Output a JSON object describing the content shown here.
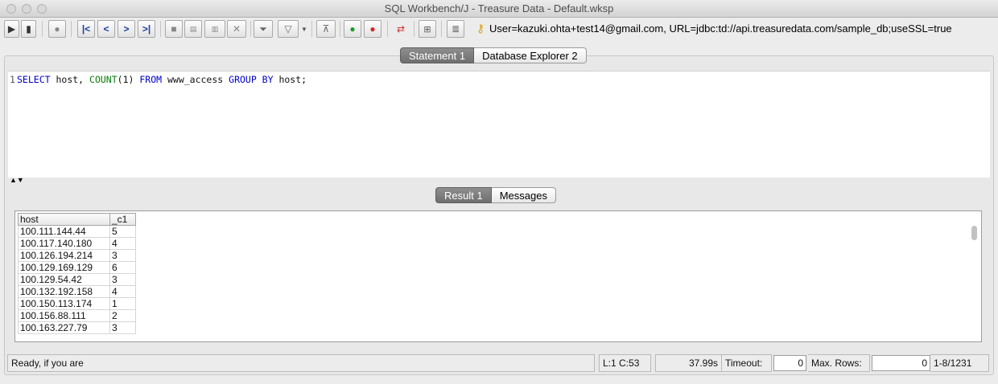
{
  "window": {
    "title": "SQL Workbench/J - Treasure Data - Default.wksp"
  },
  "toolbar": {
    "connection_info": "User=kazuki.ohta+test14@gmail.com, URL=jdbc:td://api.treasuredata.com/sample_db;useSSL=true"
  },
  "editor_tabs": [
    "Statement 1",
    "Database Explorer 2"
  ],
  "editor": {
    "line_number": "1",
    "sql_tokens": [
      {
        "t": "SELECT",
        "k": "kw"
      },
      {
        "t": " host, ",
        "k": ""
      },
      {
        "t": "COUNT",
        "k": "fn"
      },
      {
        "t": "(1) ",
        "k": ""
      },
      {
        "t": "FROM",
        "k": "kw"
      },
      {
        "t": " www_access ",
        "k": ""
      },
      {
        "t": "GROUP BY",
        "k": "kw"
      },
      {
        "t": " host;",
        "k": ""
      }
    ]
  },
  "result_tabs": [
    "Result 1",
    "Messages"
  ],
  "results": {
    "columns": [
      "host",
      "_c1"
    ],
    "rows": [
      [
        "100.111.144.44",
        "5"
      ],
      [
        "100.117.140.180",
        "4"
      ],
      [
        "100.126.194.214",
        "3"
      ],
      [
        "100.129.169.129",
        "6"
      ],
      [
        "100.129.54.42",
        "3"
      ],
      [
        "100.132.192.158",
        "4"
      ],
      [
        "100.150.113.174",
        "1"
      ],
      [
        "100.156.88.111",
        "2"
      ],
      [
        "100.163.227.79",
        "3"
      ]
    ]
  },
  "status": {
    "message": "Ready, if you are",
    "position": "L:1 C:53",
    "time": "37.99s",
    "timeout_label": "Timeout:",
    "timeout_value": "0",
    "max_rows_label": "Max. Rows:",
    "max_rows_value": "0",
    "row_range": "1-8/1231"
  }
}
